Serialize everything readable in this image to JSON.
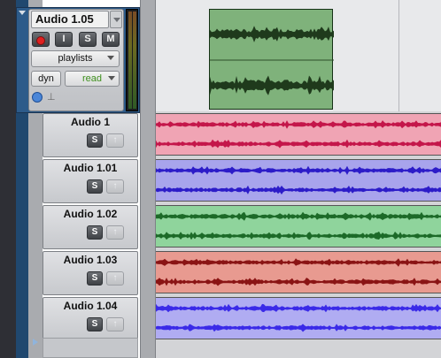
{
  "parent_track": {
    "name": "Audio 1.05",
    "buttons": {
      "record_glyph": "record-dot",
      "input": "I",
      "solo": "S",
      "mute": "M"
    },
    "view_selector": "playlists",
    "automation": {
      "type": "dyn",
      "mode": "read"
    },
    "clip_color": "#7fb27b"
  },
  "playlists": [
    {
      "name": "Audio 1",
      "solo": "S",
      "copy": "↑",
      "color": "#f0a4b4",
      "wave": "#c4164a"
    },
    {
      "name": "Audio 1.01",
      "solo": "S",
      "copy": "↑",
      "color": "#a8a4ec",
      "wave": "#2c1cc8"
    },
    {
      "name": "Audio 1.02",
      "solo": "S",
      "copy": "↑",
      "color": "#8fd49c",
      "wave": "#1c6a28"
    },
    {
      "name": "Audio 1.03",
      "solo": "S",
      "copy": "↑",
      "color": "#e89a90",
      "wave": "#8a1414"
    },
    {
      "name": "Audio 1.04",
      "solo": "S",
      "copy": "↑",
      "color": "#b0acf2",
      "wave": "#3a2ae8"
    }
  ]
}
